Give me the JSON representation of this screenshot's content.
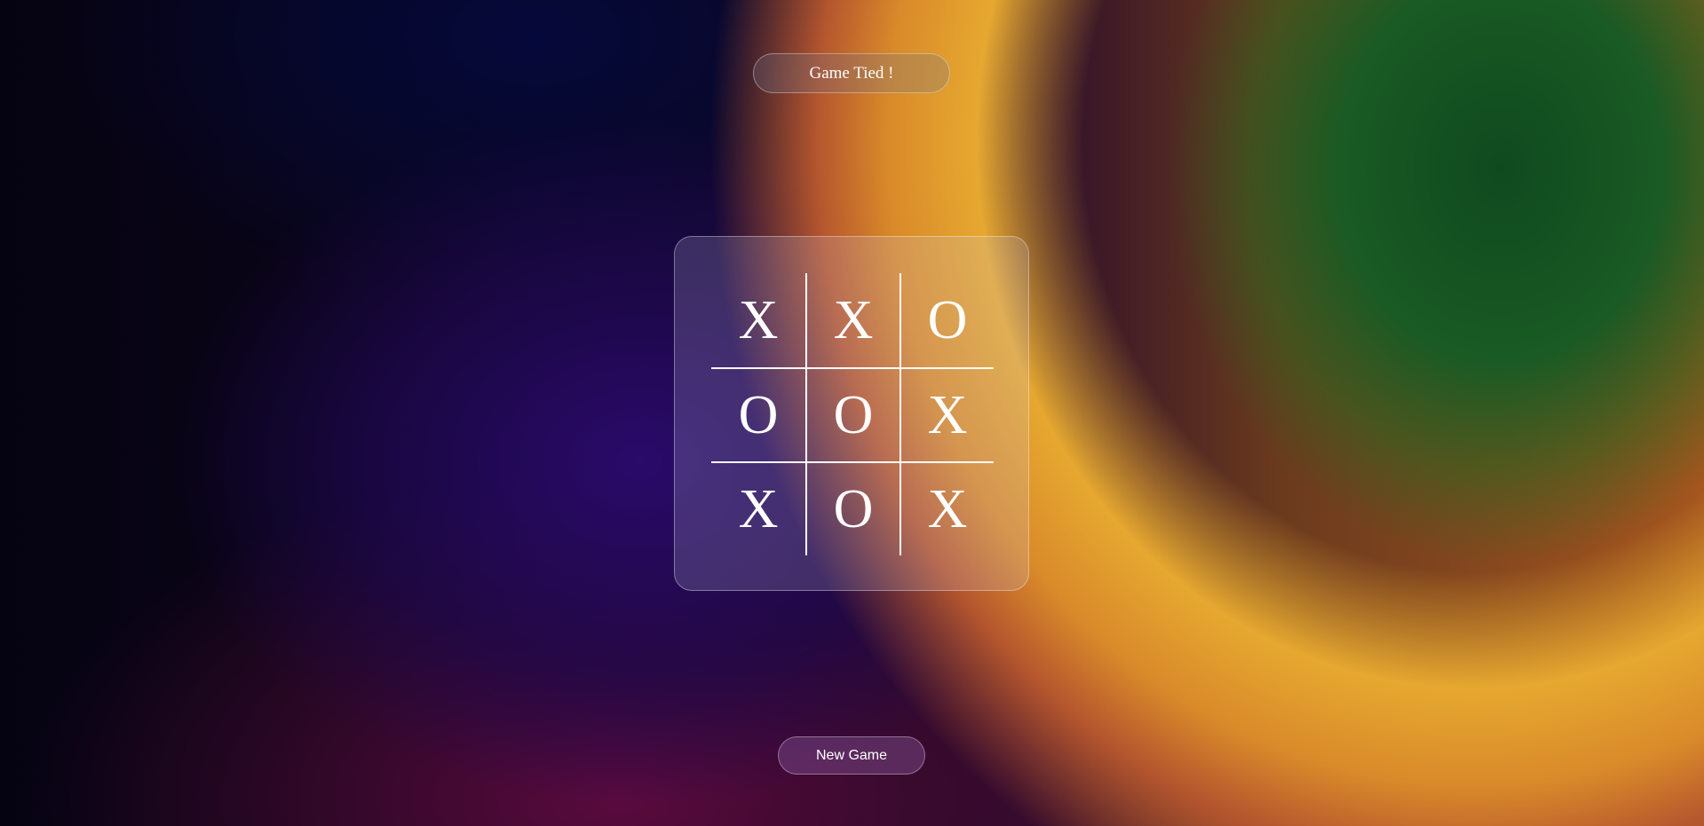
{
  "status": {
    "text": "Game Tied !"
  },
  "board": {
    "cells": [
      [
        "X",
        "X",
        "O"
      ],
      [
        "O",
        "O",
        "X"
      ],
      [
        "X",
        "O",
        "X"
      ]
    ]
  },
  "controls": {
    "new_game_label": "New Game"
  },
  "colors": {
    "text": "#ffffff",
    "grid_lines": "#ffffff",
    "background_left": "#0a0416",
    "background_glow_orange": "#e6a830",
    "background_glow_green": "#1a5a24",
    "background_glow_purple": "#2a0a6a"
  }
}
